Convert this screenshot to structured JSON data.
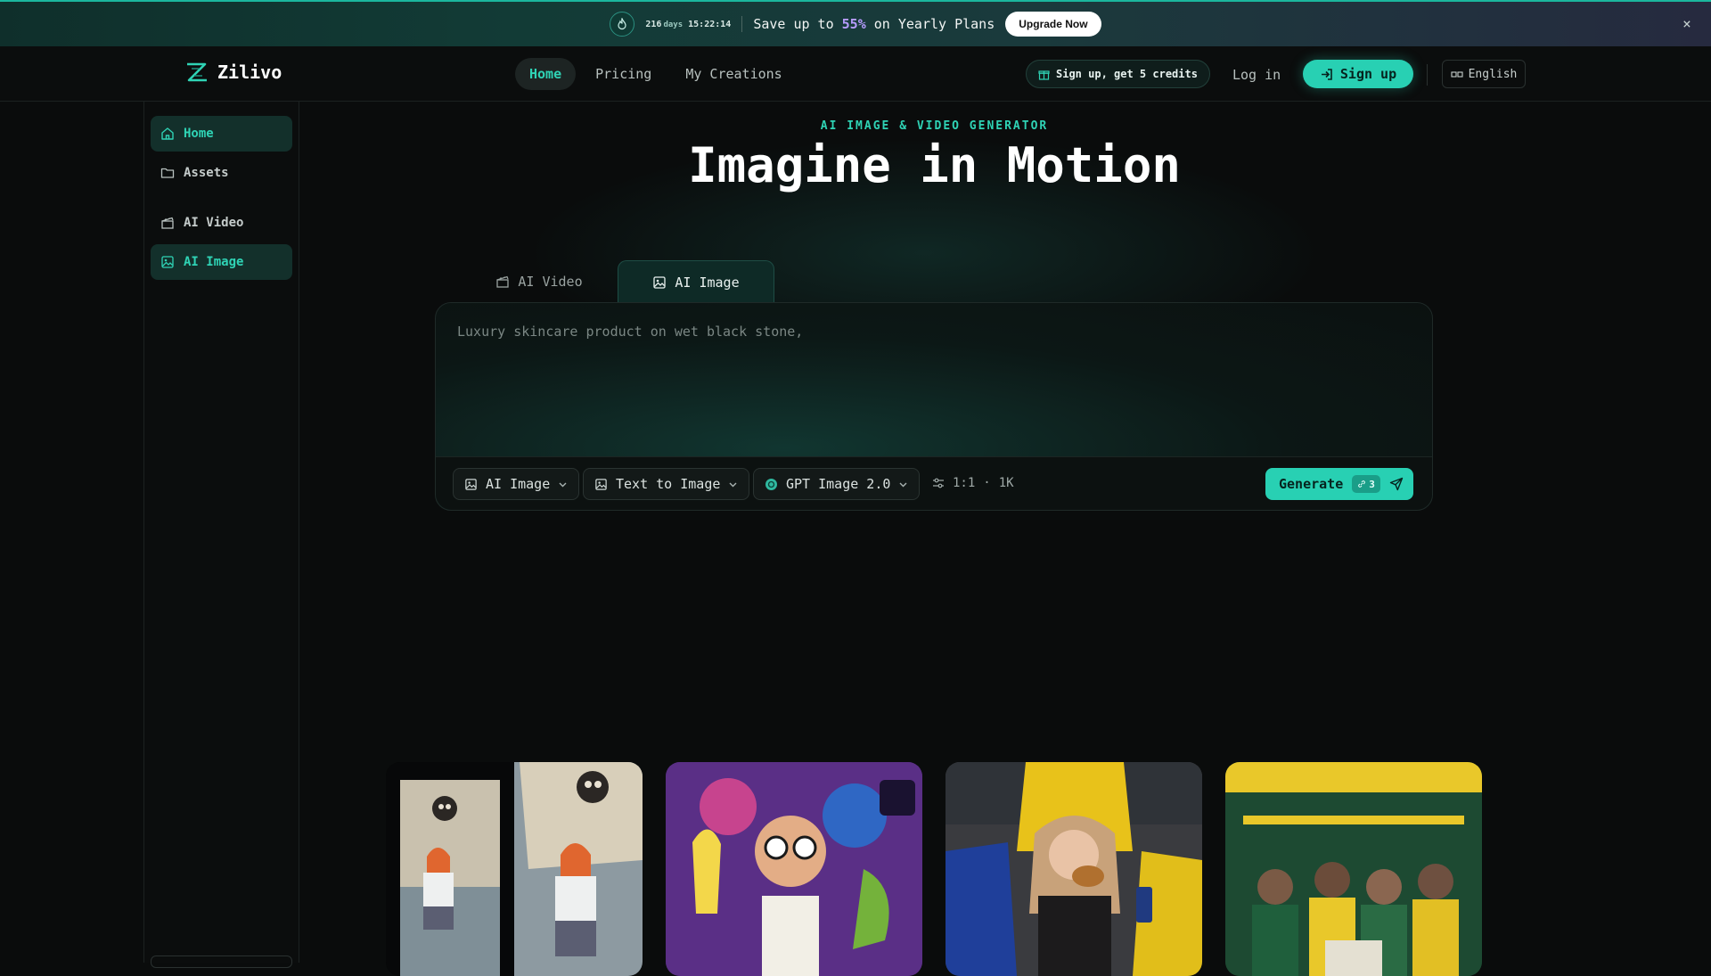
{
  "banner": {
    "timer_days": "216",
    "timer_days_unit": "days",
    "timer_clock": "15:22:14",
    "promo_prefix": "Save up to ",
    "promo_percent": "55%",
    "promo_suffix": " on Yearly Plans",
    "upgrade_label": "Upgrade Now",
    "close_icon": "×"
  },
  "header": {
    "logo_name": "Zilivo",
    "nav": [
      {
        "label": "Home",
        "active": true
      },
      {
        "label": "Pricing"
      },
      {
        "label": "My Creations"
      }
    ],
    "credits_label": "Sign up, get 5 credits",
    "login_label": "Log in",
    "signup_label": "Sign up",
    "language_label": "English"
  },
  "sidebar": {
    "items": [
      {
        "label": "Home",
        "icon": "home-icon",
        "active": true
      },
      {
        "label": "Assets",
        "icon": "folder-icon"
      },
      {
        "label": "AI Video",
        "icon": "clapperboard-icon"
      },
      {
        "label": "AI Image",
        "icon": "image-icon",
        "active": true
      }
    ]
  },
  "hero": {
    "eyebrow": "AI IMAGE & VIDEO GENERATOR",
    "title": "Imagine in Motion"
  },
  "composer": {
    "tabs": [
      {
        "label": "AI Video",
        "icon": "clapperboard-icon"
      },
      {
        "label": "AI Image",
        "icon": "image-icon",
        "active": true
      }
    ],
    "prompt_text": "Luxury skincare product on wet black stone,",
    "mode_label": "AI Image",
    "type_label": "Text to Image",
    "model_label": "GPT Image 2.0",
    "ratio_label": "1:1",
    "ratio_sep": "·",
    "resolution_label": "1K",
    "generate_label": "Generate",
    "generate_cost": "3"
  },
  "gallery": [
    {
      "name": "gallery-card-anime-girl-pirate-ship"
    },
    {
      "name": "gallery-card-tiktok-monsters-poster"
    },
    {
      "name": "gallery-card-stadium-fan-burger"
    },
    {
      "name": "gallery-card-brasil-world-cup-poster"
    }
  ],
  "colors": {
    "accent": "#28d0b3",
    "accent_text": "#2fd3b5",
    "background": "#0a0c0c",
    "promo_percent": "#b79cff"
  }
}
